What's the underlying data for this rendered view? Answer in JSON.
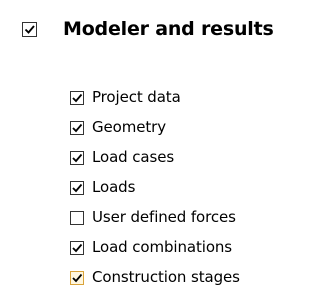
{
  "section": {
    "title": "Modeler and results",
    "checked": true
  },
  "options": [
    {
      "label": "Project data",
      "checked": true
    },
    {
      "label": "Geometry",
      "checked": true
    },
    {
      "label": "Load cases",
      "checked": true
    },
    {
      "label": "Loads",
      "checked": true
    },
    {
      "label": "User defined forces",
      "checked": false
    },
    {
      "label": "Load combinations",
      "checked": true
    },
    {
      "label": "Construction stages",
      "checked": true,
      "highlighted": true
    }
  ],
  "colors": {
    "check": "#000000",
    "hover_border": "#d9a33a",
    "hover_fill": "#fff7e0"
  }
}
